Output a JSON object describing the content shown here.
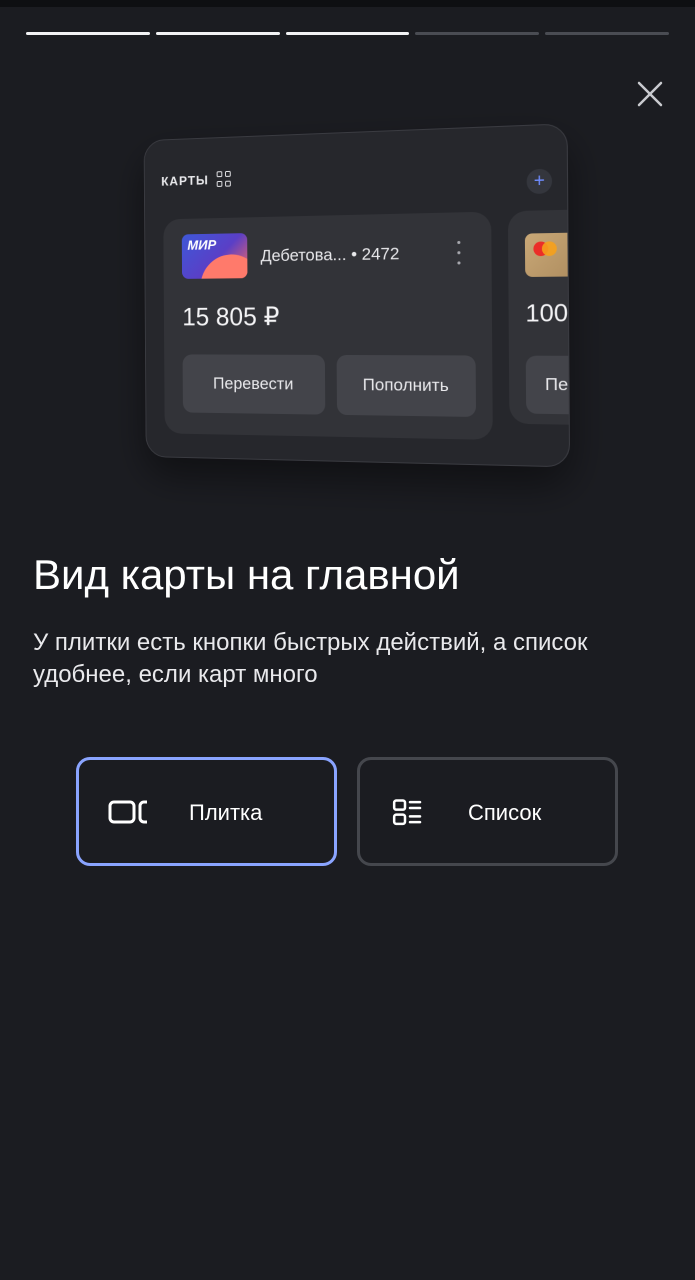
{
  "story_progress": {
    "total_segments": 5,
    "completed_segments": 3
  },
  "close": {
    "icon": "close-icon"
  },
  "preview": {
    "section_title": "КАРТЫ",
    "section_icon": "grid-icon",
    "add_icon": "plus-icon",
    "add_symbol": "+",
    "card": {
      "logo_text": "МИР",
      "name": "Дебетова... • 2472",
      "balance": "15 805 ₽",
      "actions": [
        "Перевести",
        "Пополнить"
      ]
    },
    "second_card": {
      "balance": "100",
      "action": "Пе"
    }
  },
  "headline": "Вид карты на главной",
  "description": "У плитки есть кнопки быстрых действий, а список удобнее, если карт много",
  "options": [
    {
      "label": "Плитка",
      "icon": "tile-view-icon",
      "selected": true
    },
    {
      "label": "Список",
      "icon": "list-view-icon",
      "selected": false
    }
  ],
  "colors": {
    "background": "#1b1c21",
    "selected_border": "#8aa4ff",
    "option_border": "#45474d",
    "progress_done": "#f2f2f4",
    "progress_pending": "#4a4c53"
  }
}
